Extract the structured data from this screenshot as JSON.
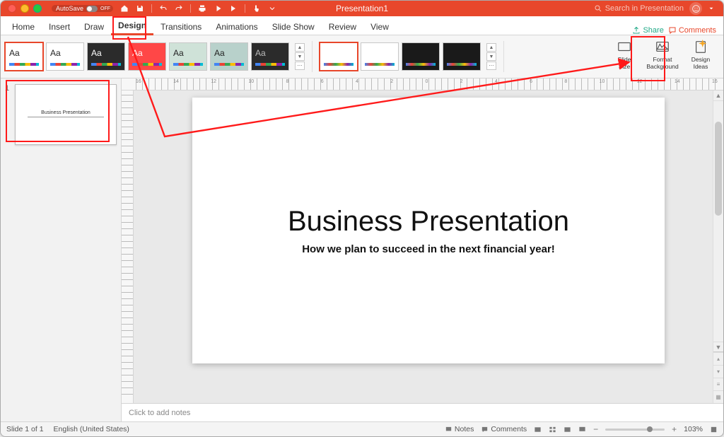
{
  "titlebar": {
    "autosave": "AutoSave",
    "autosave_state": "OFF",
    "doc_title": "Presentation1",
    "search_placeholder": "Search in Presentation"
  },
  "tabs": {
    "items": [
      "Home",
      "Insert",
      "Draw",
      "Design",
      "Transitions",
      "Animations",
      "Slide Show",
      "Review",
      "View"
    ],
    "active_index": 3,
    "share": "Share",
    "comments": "Comments"
  },
  "ribbon": {
    "themes": [
      {
        "aa": "Aa",
        "bg": "#ffffff",
        "selected": true
      },
      {
        "aa": "Aa",
        "bg": "#ffffff"
      },
      {
        "aa": "Aa",
        "bg": "#2b2b2b",
        "fg": "#fff"
      },
      {
        "aa": "Aa",
        "bg": "#ff4747",
        "fg": "#fff"
      },
      {
        "aa": "Aa",
        "bg": "#cfe2d8"
      },
      {
        "aa": "Aa",
        "bg": "#b8d1cb"
      },
      {
        "aa": "Aa",
        "bg": "#2b2b2b",
        "fg": "#bbb"
      }
    ],
    "variants": [
      {
        "stripe": "linear-gradient(to right,#4285f4,#ea4335,#34a853,#fbbc05,#8e24aa,#00bcd4)",
        "selected": true
      },
      {
        "stripe": "linear-gradient(to right,#4285f4,#ea4335,#34a853,#fbbc05,#8e24aa,#00bcd4)"
      },
      {
        "bg": "#1a1a1a",
        "stripe": "linear-gradient(to right,#4285f4,#ea4335,#34a853,#fbbc05,#8e24aa,#00bcd4)"
      },
      {
        "bg": "#1a1a1a",
        "stripe": "linear-gradient(to right,#4285f4,#ea4335,#34a853,#fbbc05,#8e24aa,#00bcd4)"
      }
    ],
    "buttons": {
      "slide_size": "Slide\nSize",
      "format_bg": "Format\nBackground",
      "design_ideas": "Design\nIdeas"
    }
  },
  "ruler_numbers": [
    "16",
    "14",
    "12",
    "10",
    "8",
    "6",
    "4",
    "2",
    "0",
    "2",
    "4",
    "6",
    "8",
    "10",
    "12",
    "14",
    "16"
  ],
  "slides": [
    {
      "num": "1",
      "title": "Business Presentation",
      "subtitle": "How we plan to succeed in the next financial year!"
    }
  ],
  "slide_content": {
    "title": "Business Presentation",
    "subtitle": "How we plan to succeed in the next financial year!"
  },
  "notes_placeholder": "Click to add notes",
  "statusbar": {
    "slide_of": "Slide 1 of 1",
    "lang": "English (United States)",
    "notes": "Notes",
    "comments": "Comments",
    "zoom": "103%"
  }
}
